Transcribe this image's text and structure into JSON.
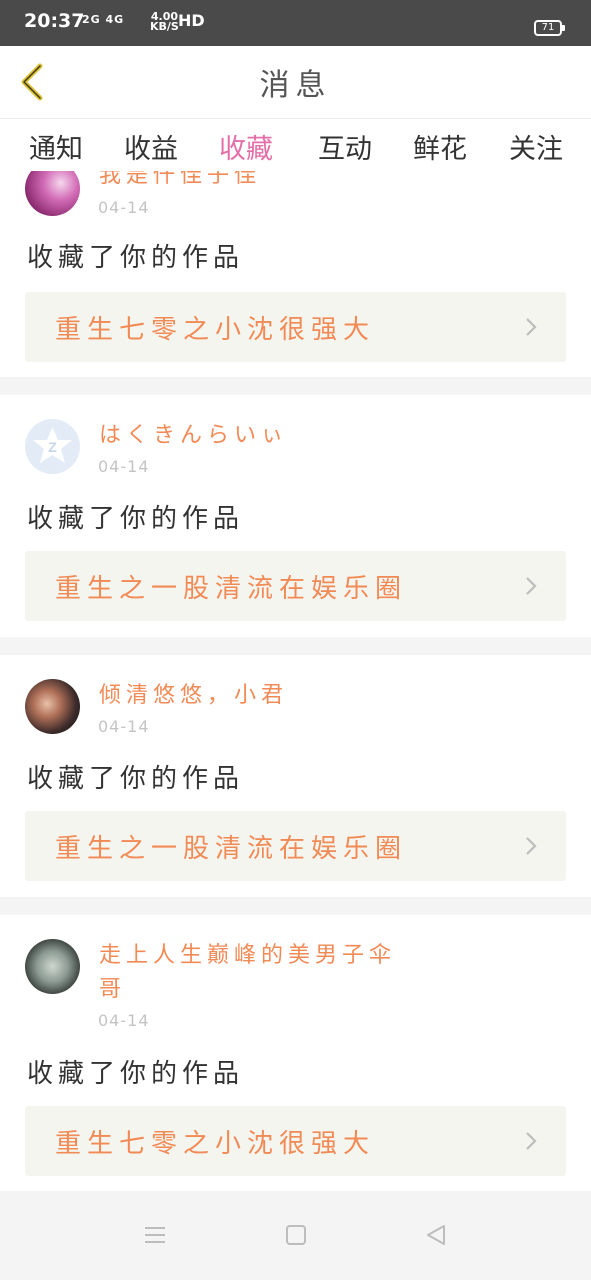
{
  "status_bar": {
    "time": "20:37",
    "signal": "2G 4G",
    "speed_value": "4.00",
    "speed_unit": "KB/S",
    "hd": "HD",
    "battery": "71"
  },
  "header": {
    "title": "消息",
    "back_icon": "chevron-left-icon",
    "back_color": "#d9c13a"
  },
  "tabs": {
    "items": [
      "通知",
      "收益",
      "收藏",
      "互动",
      "鲜花",
      "关注"
    ],
    "active_index": 2,
    "active_color": "#e46fa8"
  },
  "feed": {
    "items": [
      {
        "user_name": "我是仟佳子佳",
        "date": "04-14",
        "action": "收藏了你的作品",
        "work_title": "重生七零之小沈很强大",
        "avatar": "pink-avatar"
      },
      {
        "user_name": "はくきんらいぃ",
        "date": "04-14",
        "action": "收藏了你的作品",
        "work_title": "重生之一股清流在娱乐圈",
        "avatar": "default-avatar"
      },
      {
        "user_name": "倾清悠悠，小君",
        "date": "04-14",
        "action": "收藏了你的作品",
        "work_title": "重生之一股清流在娱乐圈",
        "avatar": "photo-avatar"
      },
      {
        "user_name": "走上人生巅峰的美男子伞哥",
        "date": "04-14",
        "action": "收藏了你的作品",
        "work_title": "重生七零之小沈很强大",
        "avatar": "photo-avatar"
      }
    ]
  },
  "colors": {
    "accent_orange": "#f28a56",
    "card_link_bg": "#f5f5ef"
  },
  "nav_bar": {
    "icons": [
      "menu-icon",
      "home-square-icon",
      "back-triangle-icon"
    ]
  }
}
